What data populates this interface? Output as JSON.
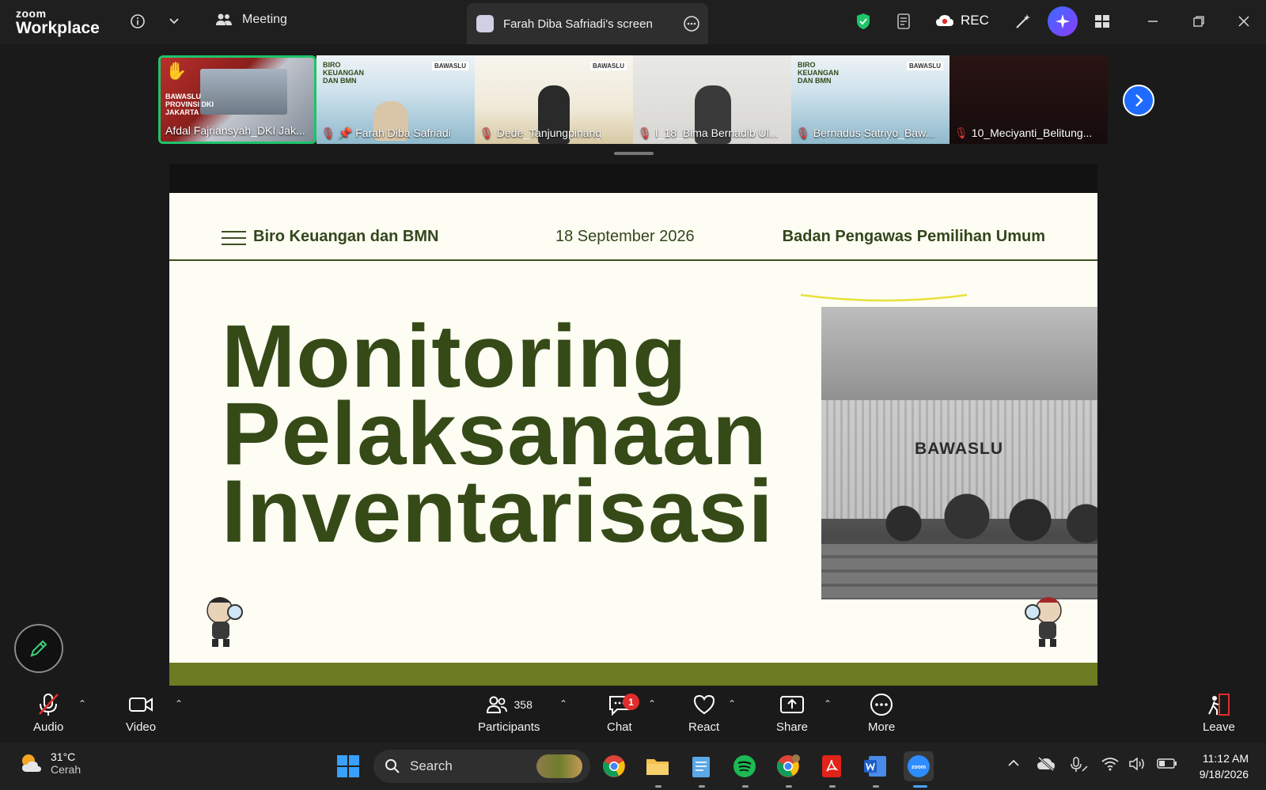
{
  "app": {
    "logo_line1": "zoom",
    "logo_line2": "Workplace",
    "meeting_label": "Meeting",
    "screen_tab_label": "Farah Diba Safriadi's screen",
    "rec_label": "REC"
  },
  "participants_strip": [
    {
      "name": "Afdal Fajriansyah_DKI Jak...",
      "overlay": "BAWASLU PROVINSI DKI JAKARTA",
      "hand_raised": true,
      "active": true
    },
    {
      "name": "Farah Diba Safriadi",
      "pinned": true,
      "muted": true
    },
    {
      "name": "Dede_Tanjungpinang",
      "muted": true
    },
    {
      "name": "I_18_Bima Bernadib Ul...",
      "muted": true
    },
    {
      "name": "Bernadus Satriyo_Baw...",
      "muted": true
    },
    {
      "name": "10_Meciyanti_Belitung...",
      "muted": true
    }
  ],
  "thumb_slide_text": {
    "title": "BIRO KEUANGAN DAN BMN",
    "logo": "BAWASLU"
  },
  "slide": {
    "header_left": "Biro Keuangan dan BMN",
    "header_date": "18 September 2026",
    "header_right": "Badan Pengawas Pemilihan Umum",
    "title_line1": "Monitoring",
    "title_line2": "Pelaksanaan",
    "title_line3": "Inventarisasi",
    "photo_sign": "BAWASLU"
  },
  "toolbar": {
    "audio": "Audio",
    "video": "Video",
    "participants": "Participants",
    "participants_count": "358",
    "chat": "Chat",
    "chat_badge": "1",
    "react": "React",
    "share": "Share",
    "more": "More",
    "leave": "Leave"
  },
  "taskbar": {
    "temperature": "31°C",
    "weather": "Cerah",
    "search_placeholder": "Search",
    "time": "11:12 AM",
    "date": "9/18/2026"
  },
  "colors": {
    "slide_green": "#354a17",
    "footer_olive": "#6d7b22",
    "active_border": "#1ec46a",
    "accent_blue": "#1f6bff"
  }
}
